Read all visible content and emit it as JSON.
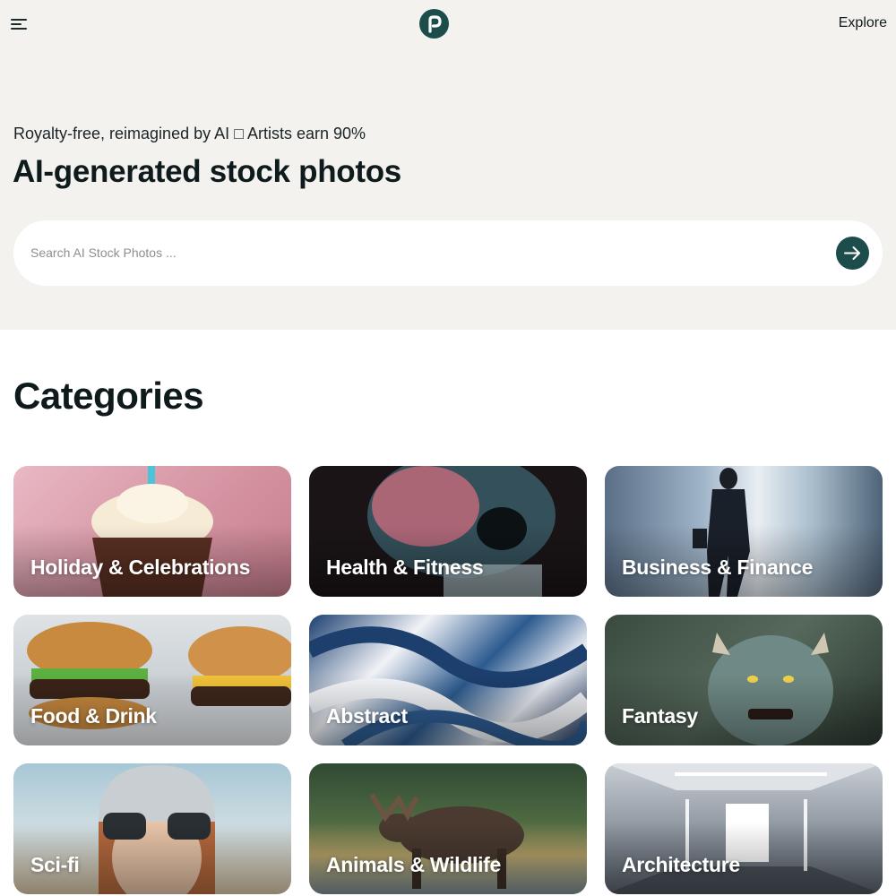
{
  "header": {
    "menu_icon": "hamburger-menu-icon",
    "logo_icon": "brand-logo-p-icon",
    "explore_label": "Explore"
  },
  "hero": {
    "tagline": "Royalty-free, reimagined by AI □ Artists earn 90%",
    "headline": "AI-generated stock photos"
  },
  "search": {
    "placeholder": "Search AI Stock Photos ...",
    "value": "",
    "submit_icon": "arrow-right-icon"
  },
  "categories": {
    "title": "Categories",
    "items": [
      {
        "label": "Holiday & Celebrations"
      },
      {
        "label": "Health & Fitness"
      },
      {
        "label": "Business & Finance"
      },
      {
        "label": "Food & Drink"
      },
      {
        "label": "Abstract"
      },
      {
        "label": "Fantasy"
      },
      {
        "label": "Sci-fi"
      },
      {
        "label": "Animals & Wildlife"
      },
      {
        "label": "Architecture"
      }
    ]
  },
  "colors": {
    "brand": "#1c4d4a",
    "hero_background": "#f3f2ef",
    "text": "#111a1c"
  }
}
